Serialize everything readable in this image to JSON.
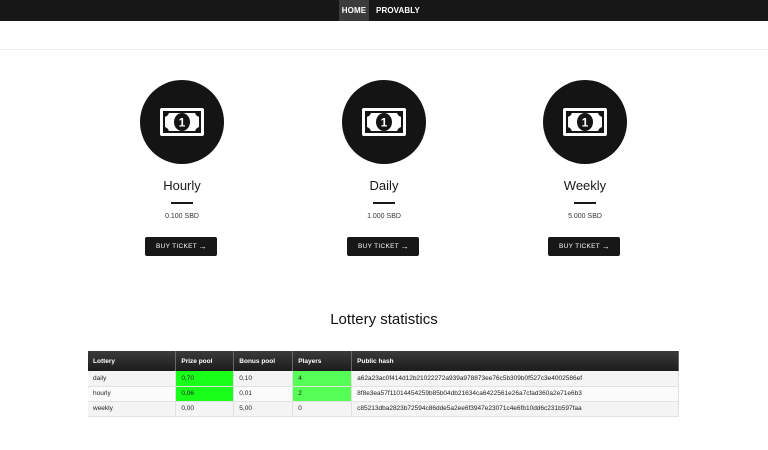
{
  "nav": {
    "home": "HOME",
    "provably_fair": "PROVABLY FAIR"
  },
  "lotteries": [
    {
      "title": "Hourly",
      "price": "0.100 SBD",
      "button": "BUY TICKET",
      "icon": "money-bill-icon",
      "arrow": "→"
    },
    {
      "title": "Daily",
      "price": "1.000 SBD",
      "button": "BUY TICKET",
      "icon": "money-bill-icon",
      "arrow": "→"
    },
    {
      "title": "Weekly",
      "price": "5.000 SBD",
      "button": "BUY TICKET",
      "icon": "money-bill-icon",
      "arrow": "→"
    }
  ],
  "stats": {
    "title": "Lottery statistics",
    "headers": [
      "Lottery",
      "Prize pool",
      "Bonus pool",
      "Players",
      "Public hash"
    ],
    "rows": [
      [
        "daily",
        "0,70",
        "0,10",
        "4",
        "a62a23ac0f414d12b21022272a939a978873ee76c5b309b0f527c3e4002586ef"
      ],
      [
        "hourly",
        "0,06",
        "0,01",
        "2",
        "8f8e3ea57f11014454259b85b04db21634ca6422561e26a7cfad360a2e71e6b3"
      ],
      [
        "weekly",
        "0,00",
        "5,00",
        "0",
        "c85213dba2823b72594c86dde5a2ee6f3947e23071c4e6fb10dd6c231b597faa"
      ]
    ]
  },
  "colors": {
    "nav_bg": "#171717",
    "highlight_bright": "#19ff19",
    "highlight_soft": "#55ff55",
    "button_bg": "#171717"
  }
}
